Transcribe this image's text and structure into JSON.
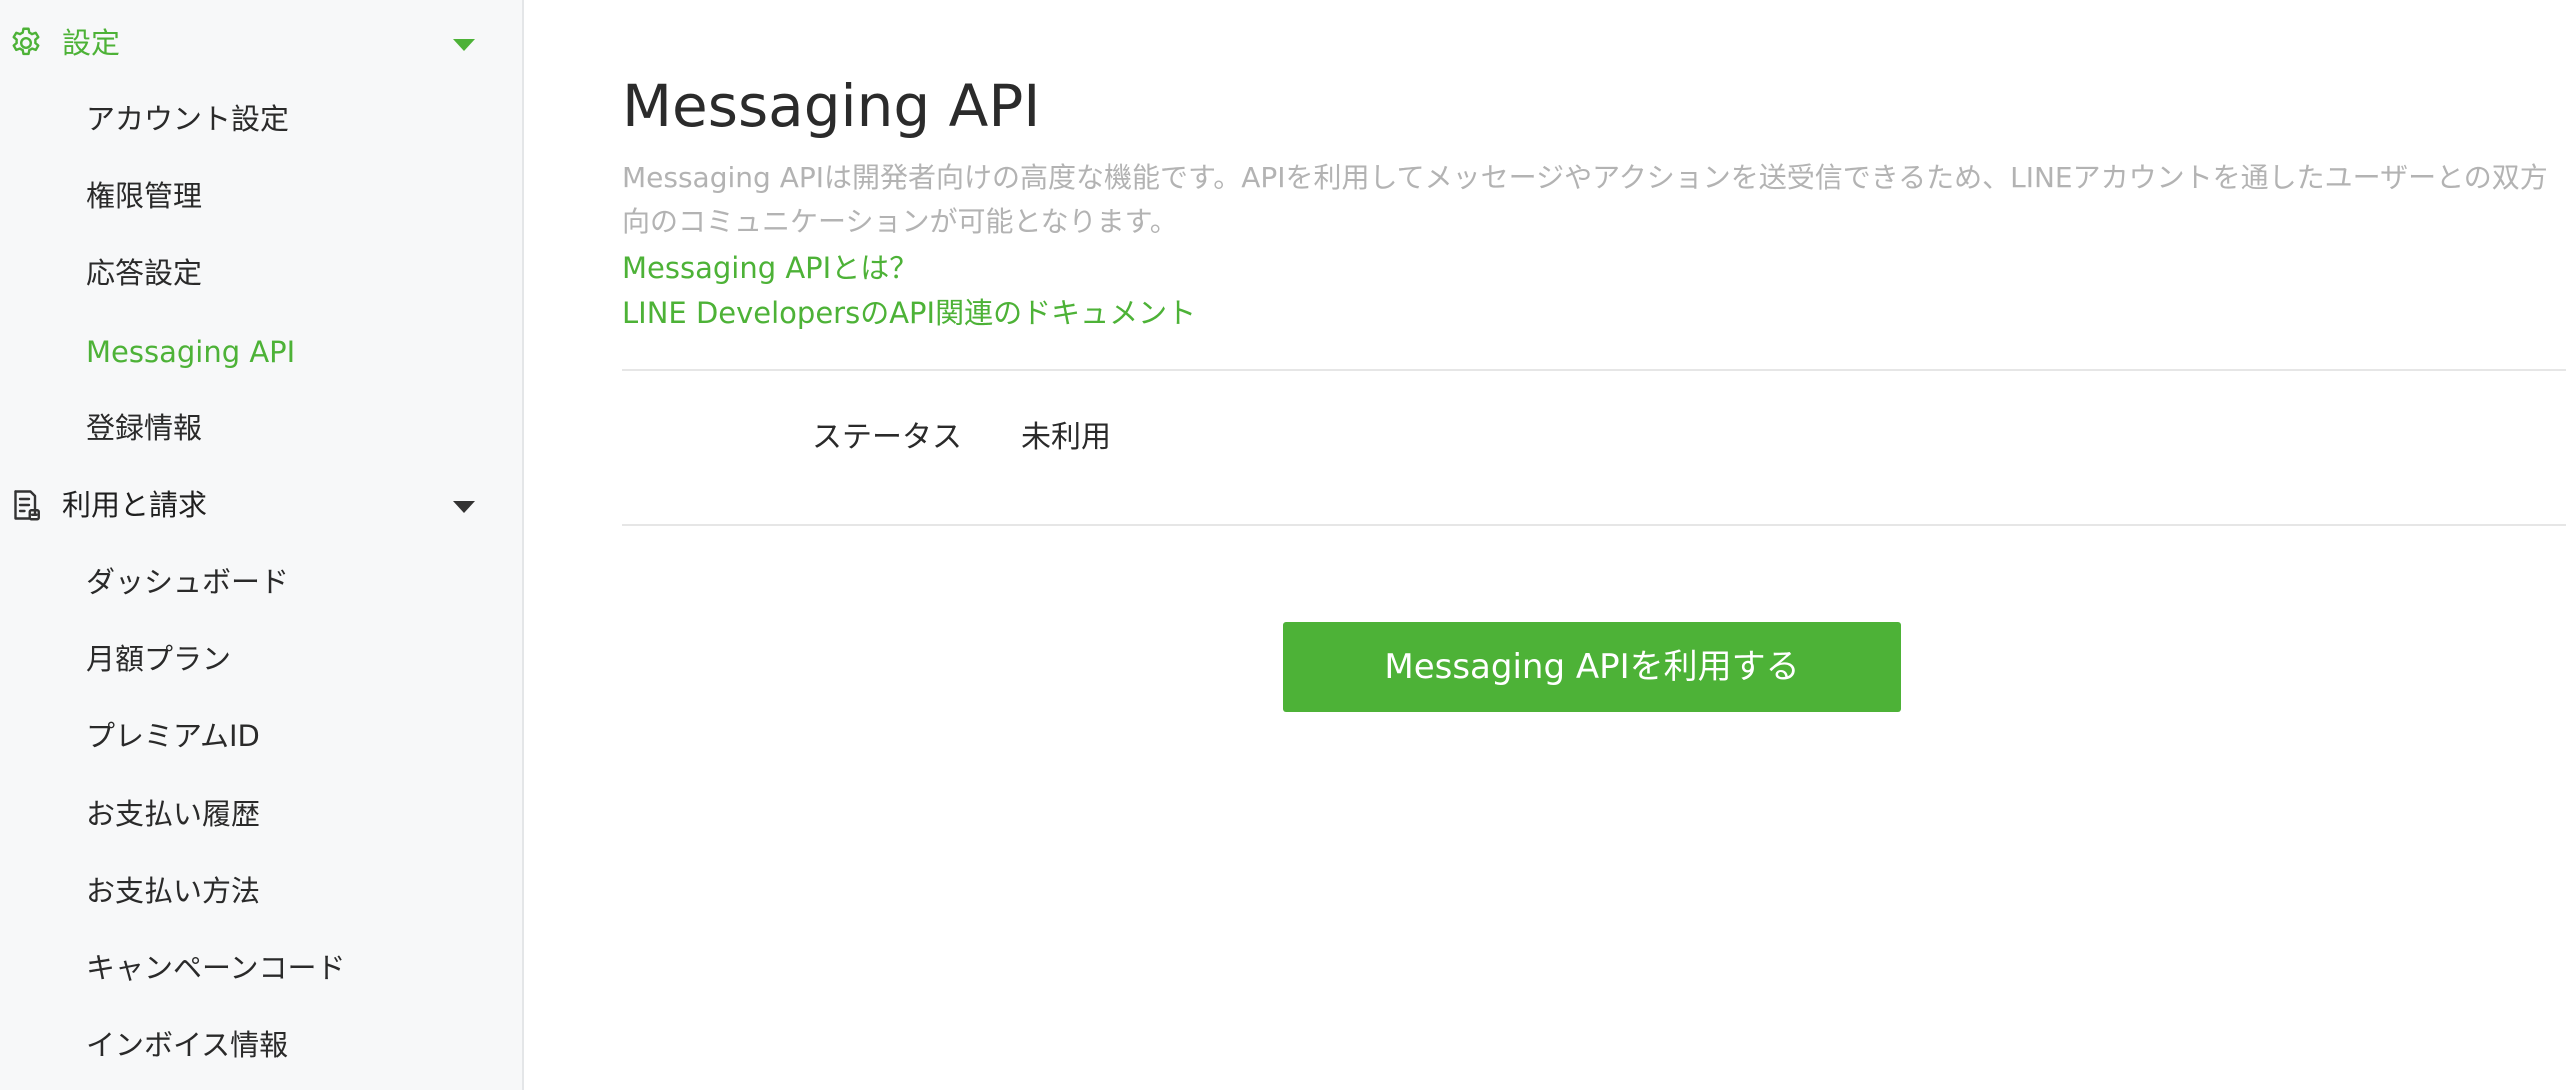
{
  "sidebar": {
    "settings": {
      "label": "設定",
      "icon": "gear-icon",
      "items": [
        "アカウント設定",
        "権限管理",
        "応答設定",
        "Messaging API",
        "登録情報"
      ],
      "active_item": "Messaging API"
    },
    "billing": {
      "label": "利用と請求",
      "icon": "receipt-icon",
      "items": [
        "ダッシュボード",
        "月額プラン",
        "プレミアムID",
        "お支払い履歴",
        "お支払い方法",
        "キャンペーンコード",
        "インボイス情報"
      ]
    }
  },
  "main": {
    "title": "Messaging API",
    "description": "Messaging APIは開発者向けの高度な機能です。APIを利用してメッセージやアクションを送受信できるため、LINEアカウントを通したユーザーとの双方向のコミュニケーションが可能となります。",
    "links": [
      "Messaging APIとは？",
      "LINE DevelopersのAPI関連のドキュメント"
    ],
    "status": {
      "label": "ステータス",
      "value": "未利用"
    },
    "cta_label": "Messaging APIを利用する"
  },
  "colors": {
    "accent": "#4db237",
    "sidebar_bg": "#f7f8f9",
    "muted_text": "#b3b3b3"
  }
}
